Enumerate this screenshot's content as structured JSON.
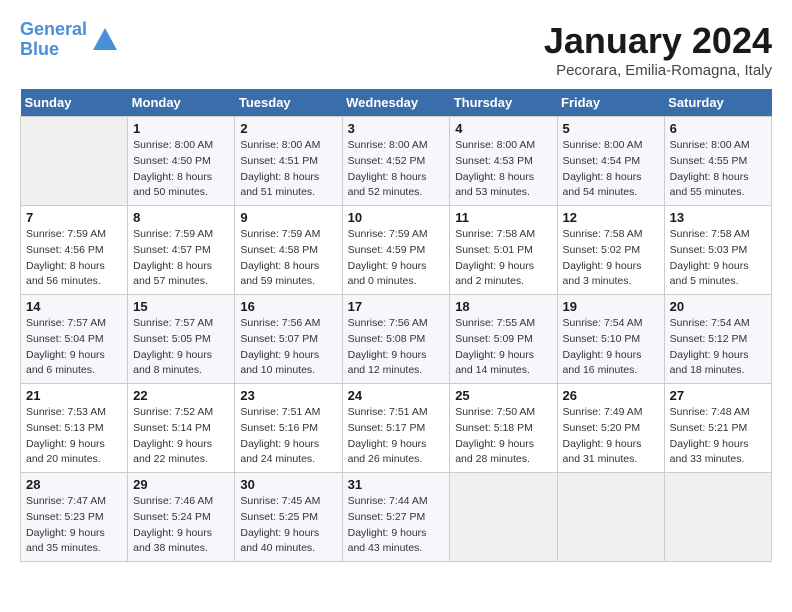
{
  "header": {
    "logo_line1": "General",
    "logo_line2": "Blue",
    "month": "January 2024",
    "location": "Pecorara, Emilia-Romagna, Italy"
  },
  "days_of_week": [
    "Sunday",
    "Monday",
    "Tuesday",
    "Wednesday",
    "Thursday",
    "Friday",
    "Saturday"
  ],
  "weeks": [
    [
      {
        "day": "",
        "info": ""
      },
      {
        "day": "1",
        "info": "Sunrise: 8:00 AM\nSunset: 4:50 PM\nDaylight: 8 hours\nand 50 minutes."
      },
      {
        "day": "2",
        "info": "Sunrise: 8:00 AM\nSunset: 4:51 PM\nDaylight: 8 hours\nand 51 minutes."
      },
      {
        "day": "3",
        "info": "Sunrise: 8:00 AM\nSunset: 4:52 PM\nDaylight: 8 hours\nand 52 minutes."
      },
      {
        "day": "4",
        "info": "Sunrise: 8:00 AM\nSunset: 4:53 PM\nDaylight: 8 hours\nand 53 minutes."
      },
      {
        "day": "5",
        "info": "Sunrise: 8:00 AM\nSunset: 4:54 PM\nDaylight: 8 hours\nand 54 minutes."
      },
      {
        "day": "6",
        "info": "Sunrise: 8:00 AM\nSunset: 4:55 PM\nDaylight: 8 hours\nand 55 minutes."
      }
    ],
    [
      {
        "day": "7",
        "info": "Sunrise: 7:59 AM\nSunset: 4:56 PM\nDaylight: 8 hours\nand 56 minutes."
      },
      {
        "day": "8",
        "info": "Sunrise: 7:59 AM\nSunset: 4:57 PM\nDaylight: 8 hours\nand 57 minutes."
      },
      {
        "day": "9",
        "info": "Sunrise: 7:59 AM\nSunset: 4:58 PM\nDaylight: 8 hours\nand 59 minutes."
      },
      {
        "day": "10",
        "info": "Sunrise: 7:59 AM\nSunset: 4:59 PM\nDaylight: 9 hours\nand 0 minutes."
      },
      {
        "day": "11",
        "info": "Sunrise: 7:58 AM\nSunset: 5:01 PM\nDaylight: 9 hours\nand 2 minutes."
      },
      {
        "day": "12",
        "info": "Sunrise: 7:58 AM\nSunset: 5:02 PM\nDaylight: 9 hours\nand 3 minutes."
      },
      {
        "day": "13",
        "info": "Sunrise: 7:58 AM\nSunset: 5:03 PM\nDaylight: 9 hours\nand 5 minutes."
      }
    ],
    [
      {
        "day": "14",
        "info": "Sunrise: 7:57 AM\nSunset: 5:04 PM\nDaylight: 9 hours\nand 6 minutes."
      },
      {
        "day": "15",
        "info": "Sunrise: 7:57 AM\nSunset: 5:05 PM\nDaylight: 9 hours\nand 8 minutes."
      },
      {
        "day": "16",
        "info": "Sunrise: 7:56 AM\nSunset: 5:07 PM\nDaylight: 9 hours\nand 10 minutes."
      },
      {
        "day": "17",
        "info": "Sunrise: 7:56 AM\nSunset: 5:08 PM\nDaylight: 9 hours\nand 12 minutes."
      },
      {
        "day": "18",
        "info": "Sunrise: 7:55 AM\nSunset: 5:09 PM\nDaylight: 9 hours\nand 14 minutes."
      },
      {
        "day": "19",
        "info": "Sunrise: 7:54 AM\nSunset: 5:10 PM\nDaylight: 9 hours\nand 16 minutes."
      },
      {
        "day": "20",
        "info": "Sunrise: 7:54 AM\nSunset: 5:12 PM\nDaylight: 9 hours\nand 18 minutes."
      }
    ],
    [
      {
        "day": "21",
        "info": "Sunrise: 7:53 AM\nSunset: 5:13 PM\nDaylight: 9 hours\nand 20 minutes."
      },
      {
        "day": "22",
        "info": "Sunrise: 7:52 AM\nSunset: 5:14 PM\nDaylight: 9 hours\nand 22 minutes."
      },
      {
        "day": "23",
        "info": "Sunrise: 7:51 AM\nSunset: 5:16 PM\nDaylight: 9 hours\nand 24 minutes."
      },
      {
        "day": "24",
        "info": "Sunrise: 7:51 AM\nSunset: 5:17 PM\nDaylight: 9 hours\nand 26 minutes."
      },
      {
        "day": "25",
        "info": "Sunrise: 7:50 AM\nSunset: 5:18 PM\nDaylight: 9 hours\nand 28 minutes."
      },
      {
        "day": "26",
        "info": "Sunrise: 7:49 AM\nSunset: 5:20 PM\nDaylight: 9 hours\nand 31 minutes."
      },
      {
        "day": "27",
        "info": "Sunrise: 7:48 AM\nSunset: 5:21 PM\nDaylight: 9 hours\nand 33 minutes."
      }
    ],
    [
      {
        "day": "28",
        "info": "Sunrise: 7:47 AM\nSunset: 5:23 PM\nDaylight: 9 hours\nand 35 minutes."
      },
      {
        "day": "29",
        "info": "Sunrise: 7:46 AM\nSunset: 5:24 PM\nDaylight: 9 hours\nand 38 minutes."
      },
      {
        "day": "30",
        "info": "Sunrise: 7:45 AM\nSunset: 5:25 PM\nDaylight: 9 hours\nand 40 minutes."
      },
      {
        "day": "31",
        "info": "Sunrise: 7:44 AM\nSunset: 5:27 PM\nDaylight: 9 hours\nand 43 minutes."
      },
      {
        "day": "",
        "info": ""
      },
      {
        "day": "",
        "info": ""
      },
      {
        "day": "",
        "info": ""
      }
    ]
  ]
}
